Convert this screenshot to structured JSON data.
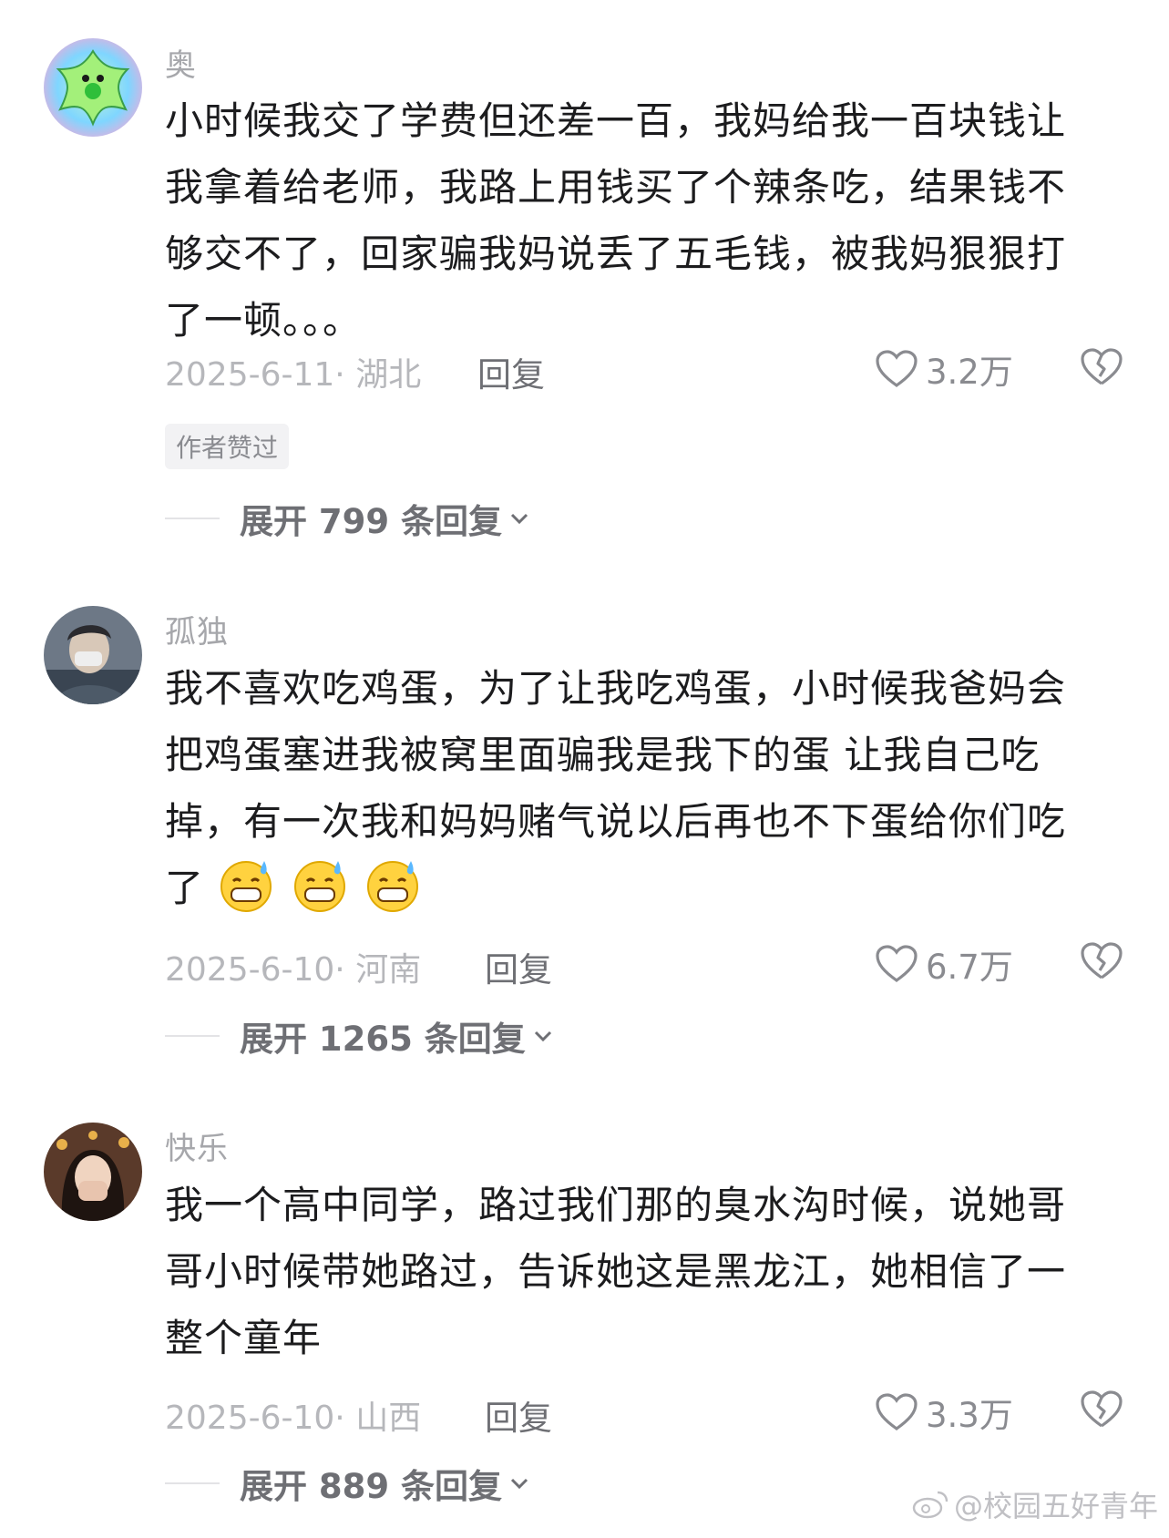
{
  "comments": [
    {
      "username": "奥",
      "text": "小时候我交了学费但还差一百，我妈给我一百块钱让我拿着给老师，我路上用钱买了个辣条吃，结果钱不够交不了，回家骗我妈说丢了五毛钱，被我妈狠狠打了一顿。。。",
      "meta": "2025-6-11· 湖北",
      "reply_label": "回复",
      "likes": "3.2万",
      "badge": "作者赞过",
      "expand_label": "展开 799 条回复",
      "avatar_icon": "green-star-avatar"
    },
    {
      "username": "孤独",
      "text": "我不喜欢吃鸡蛋，为了让我吃鸡蛋，小时候我爸妈会把鸡蛋塞进我被窝里面骗我是我下的蛋 让我自己吃掉，有一次我和妈妈赌气说以后再也不下蛋给你们吃了",
      "emojis": [
        "grin-sweat-emoji",
        "grin-sweat-emoji",
        "grin-sweat-emoji"
      ],
      "meta": "2025-6-10· 河南",
      "reply_label": "回复",
      "likes": "6.7万",
      "expand_label": "展开 1265 条回复",
      "avatar_icon": "person-photo-avatar"
    },
    {
      "username": "快乐",
      "text": "我一个高中同学，路过我们那的臭水沟时候，说她哥哥小时候带她路过，告诉她这是黑龙江，她相信了一整个童年",
      "meta": "2025-6-10· 山西",
      "reply_label": "回复",
      "likes": "3.3万",
      "expand_label": "展开 889 条回复",
      "avatar_icon": "girl-photo-avatar"
    }
  ],
  "watermark": "@校园五好青年",
  "colors": {
    "text": "#1c1c1e",
    "muted": "#b6b7bb",
    "secondary": "#6e6f74"
  }
}
